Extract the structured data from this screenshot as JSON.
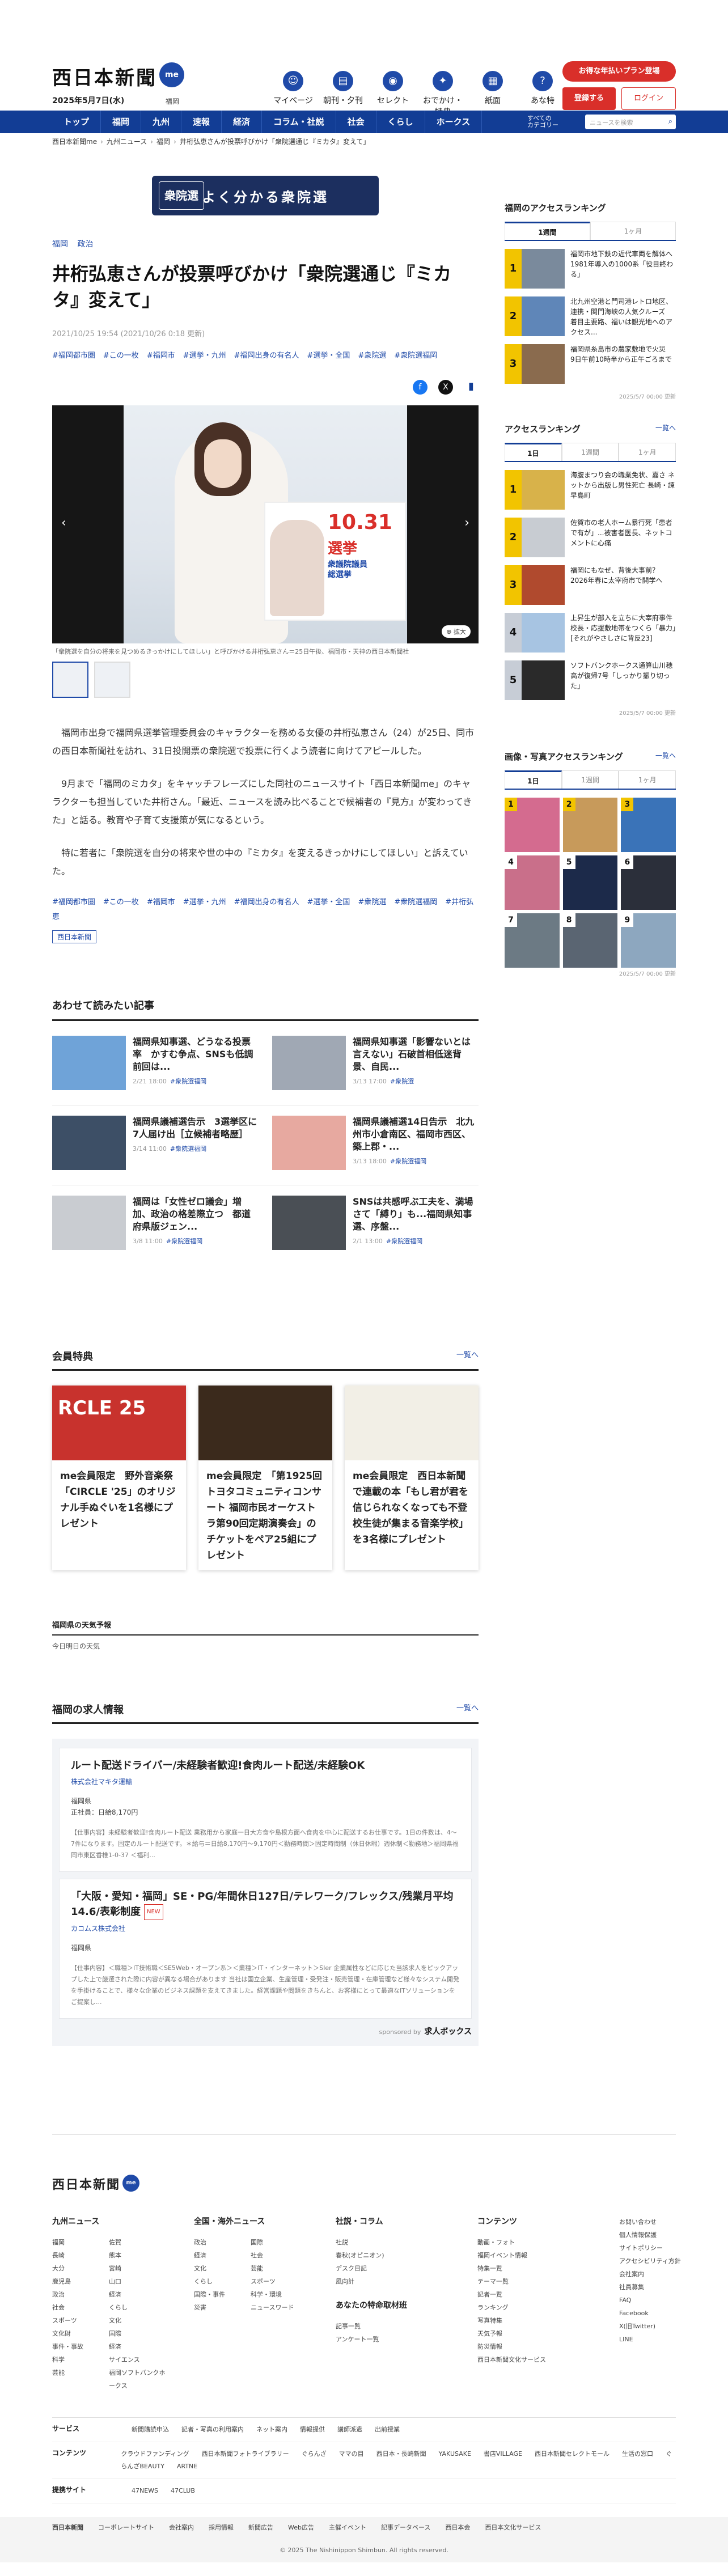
{
  "header": {
    "logo": "西日本新聞",
    "logo_badge": "me",
    "date": "2025年5月7日(水)",
    "region": "福岡",
    "icons": [
      {
        "label": "マイページ",
        "icon": "user-icon"
      },
      {
        "label": "朝刊・夕刊",
        "icon": "newspaper-icon"
      },
      {
        "label": "セレクト",
        "icon": "select-icon"
      },
      {
        "label": "おでかけ・特典",
        "icon": "ticket-icon"
      },
      {
        "label": "紙面",
        "icon": "paper-icon"
      },
      {
        "label": "あな特",
        "icon": "question-icon"
      }
    ],
    "plan_button": "お得な年払いプラン登場",
    "register_button": "登録する",
    "login_button": "ログイン"
  },
  "nav": {
    "items": [
      "トップ",
      "福岡",
      "九州",
      "速報",
      "経済",
      "コラム・社説",
      "社会",
      "くらし",
      "ホークス"
    ],
    "all_label": "すべての\nカテゴリー",
    "search_placeholder": "ニュースを検索"
  },
  "breadcrumb": [
    "西日本新聞me",
    "九州ニュース",
    "福岡",
    "井桁弘恵さんが投票呼びかけ「衆院選通じ『ミカタ』変えて」"
  ],
  "banner": {
    "badge": "衆院選",
    "text": "よく分かる衆院選"
  },
  "article": {
    "categories": [
      "福岡",
      "政治"
    ],
    "title": "井桁弘恵さんが投票呼びかけ「衆院選通じ『ミカタ』変えて」",
    "dates": "2021/10/25 19:54 (2021/10/26 0:18 更新)",
    "tags": [
      "#福岡都市圏",
      "#この一枚",
      "#福岡市",
      "#選挙・九州",
      "#福岡出身の有名人",
      "#選挙・全国",
      "#衆院選",
      "#衆院選福岡"
    ],
    "photo_caption": "「衆院選を自分の将来を見つめるきっかけにしてほしい」と呼びかける井桁弘恵さん＝25日午後、福岡市・天神の西日本新聞社",
    "poster_date": "10.31",
    "poster_main": "選挙",
    "poster_sub": "衆議院議員\n総選挙",
    "zoom_label": "拡大",
    "paragraphs": [
      "福岡市出身で福岡県選挙管理委員会のキャラクターを務める女優の井桁弘恵さん（24）が25日、同市の西日本新聞社を訪れ、31日投開票の衆院選で投票に行くよう読者に向けてアピールした。",
      "9月まで「福岡のミカタ」をキャッチフレーズにした同社のニュースサイト「西日本新聞me」のキャラクターも担当していた井桁さん。「最近、ニュースを読み比べることで候補者の『見方』が変わってきた」と話る。教育や子育て支援策が気になるという。",
      "特に若者に「衆院選を自分の将来や世の中の『ミカタ』を変えるきっかけにしてほしい」と訴えていた。"
    ],
    "tags_bottom": [
      "#福岡都市圏",
      "#この一枚",
      "#福岡市",
      "#選挙・九州",
      "#福岡出身の有名人",
      "#選挙・全国",
      "#衆院選",
      "#衆院選福岡",
      "#井桁弘恵"
    ],
    "publisher": "西日本新聞"
  },
  "related": {
    "heading": "あわせて読みたい記事",
    "items": [
      {
        "title": "福岡県知事選、どうなる投票率　かすむ争点、SNSも低調　前回は...",
        "date": "2/21 18:00",
        "tag": "#衆院選福岡",
        "color": "#6fa3d8"
      },
      {
        "title": "福岡県知事選「影響ないとは言えない」石破首相低迷背景、自民...",
        "date": "3/13 17:00",
        "tag": "#衆院選",
        "color": "#a0a8b4"
      },
      {
        "title": "福岡県議補選告示　3選挙区に7人届け出［立候補者略歴］",
        "date": "3/14 11:00",
        "tag": "#衆院選福岡",
        "color": "#3d4f66"
      },
      {
        "title": "福岡県議補選14日告示　北九州市小倉南区、福岡市西区、築上郡・...",
        "date": "3/13 18:00",
        "tag": "#衆院選福岡",
        "color": "#e7a9a0"
      },
      {
        "title": "福岡は「女性ゼロ議会」増加、政治の格差際立つ　都道府県版ジェン...",
        "date": "3/8 11:00",
        "tag": "#衆院選福岡",
        "color": "#c9ccd1"
      },
      {
        "title": "SNSは共感呼ぶ工夫を、満場さて「縛り」も...福岡県知事選、序盤...",
        "date": "2/1 13:00",
        "tag": "#衆院選福岡",
        "color": "#4a4f55"
      }
    ]
  },
  "members": {
    "heading": "会員特典",
    "more": "一覧へ",
    "cards": [
      {
        "title": "me会員限定　野外音楽祭「CIRCLE '25」のオリジナル手ぬぐいを1名様にプレゼント",
        "img_text": "RCLE 25",
        "color": "#c8322d"
      },
      {
        "title": "me会員限定　「第1925回トヨタコミュニティコンサート 福岡市民オーケストラ第90回定期演奏会」のチケットをペア25組にプレゼント",
        "img_text": "",
        "color": "#3b2a1c"
      },
      {
        "title": "me会員限定　西日本新聞で連載の本「もし君が君を信じられなくなっても不登校生徒が集まる音楽学校」を3名様にプレゼント",
        "img_text": "",
        "color": "#f2efe6"
      }
    ]
  },
  "weather": {
    "heading": "福岡県の天気予報",
    "sub": "今日明日の天気"
  },
  "jobs": {
    "heading": "福岡の求人情報",
    "more": "一覧へ",
    "items": [
      {
        "title": "ルート配送ドライバー/未経験者歓迎!食肉ルート配送/未経験OK",
        "company": "株式会社マキタ運輸",
        "location": "福岡県",
        "salary": "正社員：日給8,170円",
        "desc": "【仕事内容】未経験者歓迎!食肉ルート配送 業務用から家庭一日大方食や島根方面へ食肉を中心に配送するお仕事です。1日の件数は、4〜7件になります。固定のルート配送です。＊給与＝日給8,170円〜9,170円＜勤務時間＞固定時間制（休日休暇）週休制＜勤務地＞福岡県福岡市東区香椎1-0-37 ＜福利..."
      },
      {
        "title": "「大阪・愛知・福岡」SE・PG/年間休日127日/テレワーク/フレックス/残業月平均14.6/表彰制度",
        "company": "カコムス株式会社",
        "location": "福岡県",
        "salary": "",
        "desc": "【仕事内容】＜職種＞IT技術職＜SE5Web・オープン系＞＜業種＞IT・インターネット＞SIer 企業属性などに応じた当該求人をピックアップした上で厳選された際に内容が異なる場合があります 当社は国立企業、生産管理・受発注・販売管理・在庫管理など様々なシステム開発を手掛けることで、様々な企業のビジネス課題を支えてきました。経営課題や問題をきちんと、お客様にとって最適なITソリューションをご提案し..."
      }
    ],
    "sponsor": "sponsored by",
    "sponsor_brand": "求人ボックス"
  },
  "sidebar": {
    "access": {
      "heading": "福岡のアクセスランキング",
      "tabs": [
        "1週間",
        "1ヶ月"
      ],
      "items": [
        {
          "rank": "1",
          "text": "福岡市地下鉄の近代車両を解体へ　1981年導入の1000系「役目終わる」",
          "color": "#7a8a9c"
        },
        {
          "rank": "2",
          "text": "北九州空港と門司港レトロ地区、連携・関門海峡の人気クルーズ　着目主要路、福いは観光地へのアクセス...",
          "color": "#5f86b8"
        },
        {
          "rank": "3",
          "text": "福岡県糸島市の農家敷地で火災　9日午前10時半から正午ごろまで",
          "color": "#8a6b4e"
        }
      ],
      "date": "2025/5/7 00:00 更新"
    },
    "access_all": {
      "heading": "アクセスランキング",
      "more": "一覧へ",
      "tabs": [
        "1日",
        "1週間",
        "1ヶ月"
      ],
      "items": [
        {
          "rank": "1",
          "text": "海腹まつり会の職業免状、嘉さ ネットから出版し男性死亡 長崎・諫早島町",
          "color": "#d8b24a"
        },
        {
          "rank": "2",
          "text": "佐賀市の老人ホーム暴行死「患者で有が」...被害者医長、ネットコメントに心痛",
          "color": "#c8ccd2"
        },
        {
          "rank": "3",
          "text": "福岡にもなぜ、背後大事前？2026年春に太宰府市で開学へ",
          "color": "#b04a2e"
        },
        {
          "rank": "4",
          "text": "上昇生が部入を立ちに大宰府事件　校長・応援敷地帯をつくら「暴力」[それがやさしさに背反23]",
          "color": "#a7c4e2"
        },
        {
          "rank": "5",
          "text": "ソフトバンクホークス通算山川穂高が復帰7号「しっかり振り切った」",
          "color": "#2a2a2a"
        }
      ],
      "date": "2025/5/7 00:00 更新"
    },
    "photo_rank": {
      "heading": "画像・写真アクセスランキング",
      "more": "一覧へ",
      "tabs": [
        "1日",
        "1週間",
        "1ヶ月"
      ],
      "cells": [
        {
          "rank": "1",
          "color": "#d46b8f"
        },
        {
          "rank": "2",
          "color": "#c79a5b"
        },
        {
          "rank": "3",
          "color": "#3a73b8"
        },
        {
          "rank": "4",
          "color": "#c96f8a"
        },
        {
          "rank": "5",
          "color": "#1c2a4a"
        },
        {
          "rank": "6",
          "color": "#2b2f3a"
        },
        {
          "rank": "7",
          "color": "#6c7a84"
        },
        {
          "rank": "8",
          "color": "#5a6572"
        },
        {
          "rank": "9",
          "color": "#8da7bf"
        }
      ],
      "date": "2025/5/7 00:00 更新"
    }
  },
  "footer": {
    "logo": "西日本新聞",
    "logo_badge": "me",
    "cols": [
      {
        "heading": "九州ニュース",
        "links": [
          "福岡",
          "佐賀",
          "長崎",
          "熊本",
          "大分",
          "宮崎",
          "鹿児島",
          "山口",
          "政治",
          "経済",
          "社会",
          "くらし",
          "スポーツ",
          "文化",
          "文化財",
          "国際",
          "事件・事故",
          "経済",
          "科学",
          "サイエンス",
          "芸能",
          "福岡ソフトバンクホークス"
        ],
        "two": true
      },
      {
        "heading": "全国・海外ニュース",
        "links": [
          "政治",
          "国際",
          "経済",
          "社会",
          "文化",
          "芸能",
          "くらし",
          "スポーツ",
          "国際・事件",
          "科学・環境",
          "災害",
          "ニュースワード"
        ],
        "two": true
      },
      {
        "heading": "社説・コラム",
        "links": [
          "社説",
          "春秋(オピニオン)",
          "デスク日記",
          "風向計"
        ],
        "two": false,
        "sub_heading": "あなたの特命取材班",
        "sub_links": [
          "記事一覧",
          "アンケート一覧"
        ]
      },
      {
        "heading": "コンテンツ",
        "links": [
          "動画・フォト",
          "福岡イベント情報",
          "特集一覧",
          "テーマ一覧",
          "記者一覧",
          "ランキング",
          "写真特集",
          "天気予報",
          "防災情報",
          "西日本新聞文化サービス"
        ],
        "two": false
      },
      {
        "heading": "",
        "links": [
          "お問い合わせ",
          "個人情報保護",
          "サイトポリシー",
          "アクセシビリティ方針",
          "会社案内",
          "社員募集",
          "FAQ",
          "Facebook",
          "X(旧Twitter)",
          "LINE"
        ],
        "two": false
      }
    ],
    "rows": [
      {
        "label": "サービス",
        "links": [
          "新聞購読申込",
          "記者・写真の利用案内",
          "ネット案内",
          "情報提供",
          "講師派遣",
          "出前授業"
        ]
      },
      {
        "label": "コンテンツ",
        "links": [
          "クラウドファンディング",
          "西日本新聞フォトライブラリー",
          "ぐらんざ",
          "ママの目",
          "西日本・長崎新聞",
          "YAKUSAKE",
          "書店VILLAGE",
          "西日本新聞セレクトモール",
          "生活の窓口",
          "ぐらんざBEAUTY",
          "ARTNE"
        ]
      },
      {
        "label": "提携サイト",
        "links": [
          "47NEWS",
          "47CLUB"
        ]
      }
    ],
    "bottom_logo": "西日本新聞",
    "bottom_links": [
      "コーポレートサイト",
      "会社案内",
      "採用情報",
      "新聞広告",
      "Web広告",
      "主催イベント",
      "記事データベース",
      "西日本会",
      "西日本文化サービス"
    ],
    "copyright": "© 2025 The Nishinippon Shimbun. All rights reserved."
  }
}
